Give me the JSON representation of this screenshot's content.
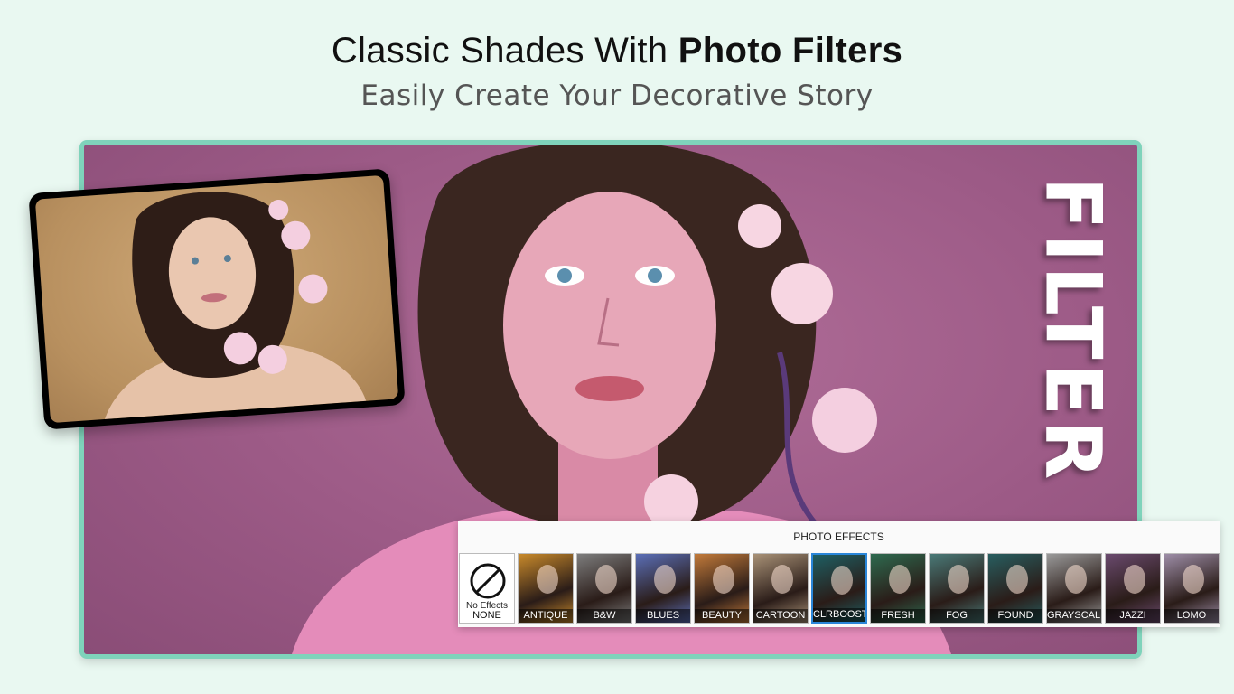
{
  "header": {
    "title_regular": "Classic Shades With",
    "title_bold": "Photo Filters",
    "subtitle": "Easily Create Your Decorative Story"
  },
  "banner": {
    "vertical_word": "FILTER"
  },
  "effects_panel": {
    "title": "PHOTO EFFECTS",
    "none_sublabel": "No Effects",
    "items": [
      {
        "label": "NONE",
        "tint": "#ffffff"
      },
      {
        "label": "ANTIQUE",
        "tint": "#c98a2b"
      },
      {
        "label": "B&W",
        "tint": "#7d7d7d"
      },
      {
        "label": "BLUES",
        "tint": "#5b6fb8"
      },
      {
        "label": "BEAUTY",
        "tint": "#c27a3a"
      },
      {
        "label": "CARTOON",
        "tint": "#a99277"
      },
      {
        "label": "CLRBOOST",
        "tint": "#1e5f63"
      },
      {
        "label": "FRESH",
        "tint": "#2e6a4f"
      },
      {
        "label": "FOG",
        "tint": "#4a7a78"
      },
      {
        "label": "FOUND",
        "tint": "#285e60"
      },
      {
        "label": "GRAYSCALE",
        "tint": "#9a9a9a"
      },
      {
        "label": "JAZZI",
        "tint": "#6a4a6e"
      },
      {
        "label": "LOMO",
        "tint": "#9e8ea8"
      }
    ]
  },
  "colors": {
    "background": "#e9f8f1",
    "frame_border": "#7fd3bb",
    "photo_bg": "#9c5a86",
    "thumb_bg": "#b8905f"
  }
}
